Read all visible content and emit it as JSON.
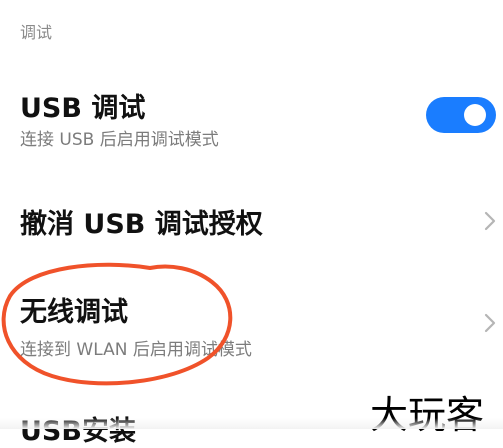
{
  "section": {
    "header": "调试"
  },
  "usb_debugging": {
    "title": "USB 调试",
    "subtitle": "连接 USB 后启用调试模式",
    "enabled": true
  },
  "revoke_usb_auth": {
    "title": "撤消 USB 调试授权"
  },
  "wireless_debugging": {
    "title": "无线调试",
    "subtitle": "连接到 WLAN 后启用调试模式"
  },
  "usb_install": {
    "title": "USB安装"
  },
  "watermark": {
    "text": "大玩客"
  },
  "colors": {
    "toggle_on": "#1a7dff",
    "annotation": "#f0522a",
    "subtitle_gray": "#7c7c7c"
  },
  "icons": [
    "chevron-right-icon",
    "chevron-right-icon"
  ]
}
